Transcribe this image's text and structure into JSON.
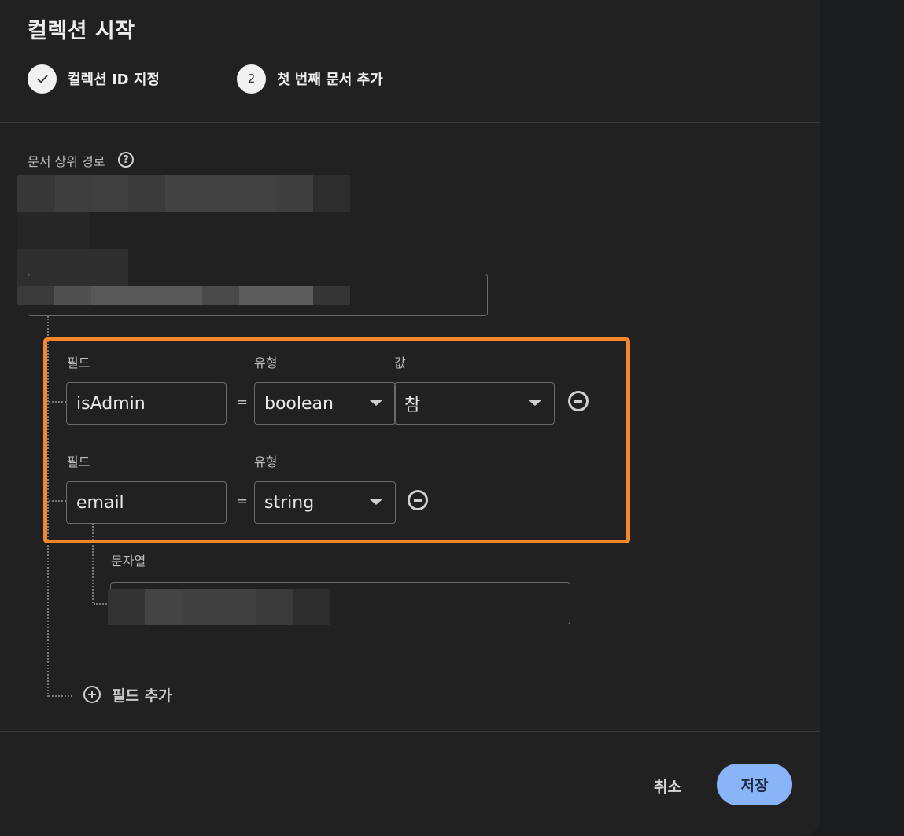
{
  "dialog": {
    "title": "컬렉션 시작",
    "steps": [
      {
        "label": "컬렉션 ID 지정",
        "state": "done",
        "icon": "check-icon"
      },
      {
        "number": "2",
        "label": "첫 번째 문서 추가",
        "state": "active"
      }
    ]
  },
  "path": {
    "label": "문서 상위 경로"
  },
  "fields": [
    {
      "field_label": "필드",
      "type_label": "유형",
      "value_label": "값",
      "name": "isAdmin",
      "equals": "=",
      "type": "boolean",
      "value": "참"
    },
    {
      "field_label": "필드",
      "type_label": "유형",
      "name": "email",
      "equals": "=",
      "type": "string",
      "value_label": "문자열",
      "value": ""
    }
  ],
  "add_field": {
    "label": "필드 추가"
  },
  "actions": {
    "cancel": "취소",
    "save": "저장"
  },
  "colors": {
    "highlight": "#f5862a",
    "primary": "#8ab4f8",
    "dialog_bg": "#212122"
  }
}
